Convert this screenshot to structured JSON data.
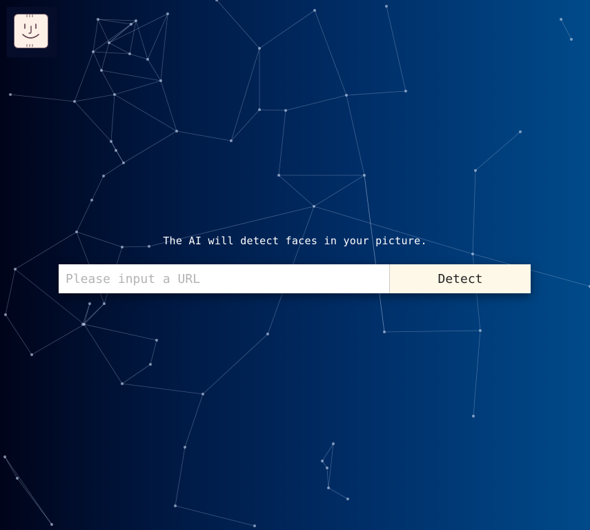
{
  "logo": {
    "icon": "smiley-face-icon"
  },
  "hero": {
    "tagline": "The AI will detect faces in your picture."
  },
  "search": {
    "placeholder": "Please input a URL",
    "value": "",
    "button_label": "Detect"
  },
  "colors": {
    "background_start": "#00041a",
    "background_end": "#004a8a",
    "button_bg": "#fdf8e8",
    "logo_face_bg": "#fdf0e6"
  }
}
